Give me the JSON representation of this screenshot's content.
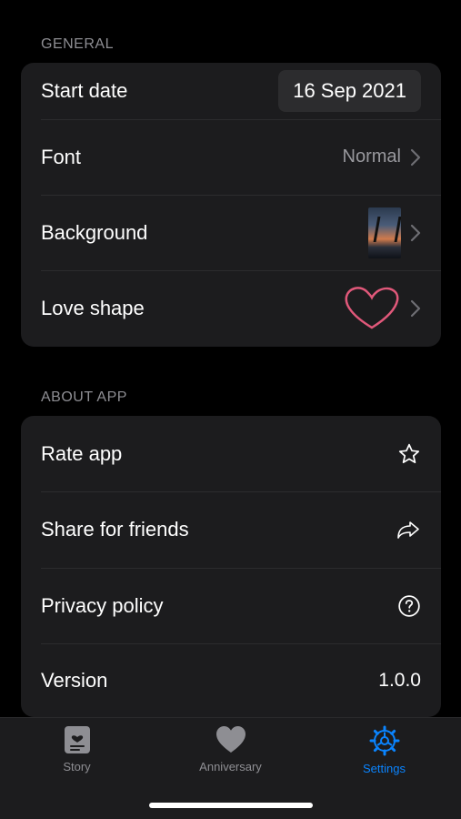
{
  "general": {
    "header": "GENERAL",
    "start_date": {
      "label": "Start date",
      "value": "16 Sep 2021"
    },
    "font": {
      "label": "Font",
      "value": "Normal"
    },
    "background": {
      "label": "Background"
    },
    "love_shape": {
      "label": "Love shape"
    }
  },
  "about": {
    "header": "ABOUT APP",
    "rate": {
      "label": "Rate app",
      "icon": "star-icon"
    },
    "share": {
      "label": "Share for friends",
      "icon": "share-arrow-icon"
    },
    "privacy": {
      "label": "Privacy policy",
      "icon": "question-circle-icon"
    },
    "version": {
      "label": "Version",
      "value": "1.0.0"
    }
  },
  "tabs": [
    {
      "label": "Story",
      "icon": "story-card-icon",
      "active": false
    },
    {
      "label": "Anniversary",
      "icon": "heart-icon",
      "active": false
    },
    {
      "label": "Settings",
      "icon": "gear-icon",
      "active": true
    }
  ],
  "colors": {
    "background": "#000000",
    "card": "#1c1c1e",
    "accent": "#0a84ff",
    "secondary_text": "#8e8e93",
    "heart_stroke": "#e0587a"
  }
}
